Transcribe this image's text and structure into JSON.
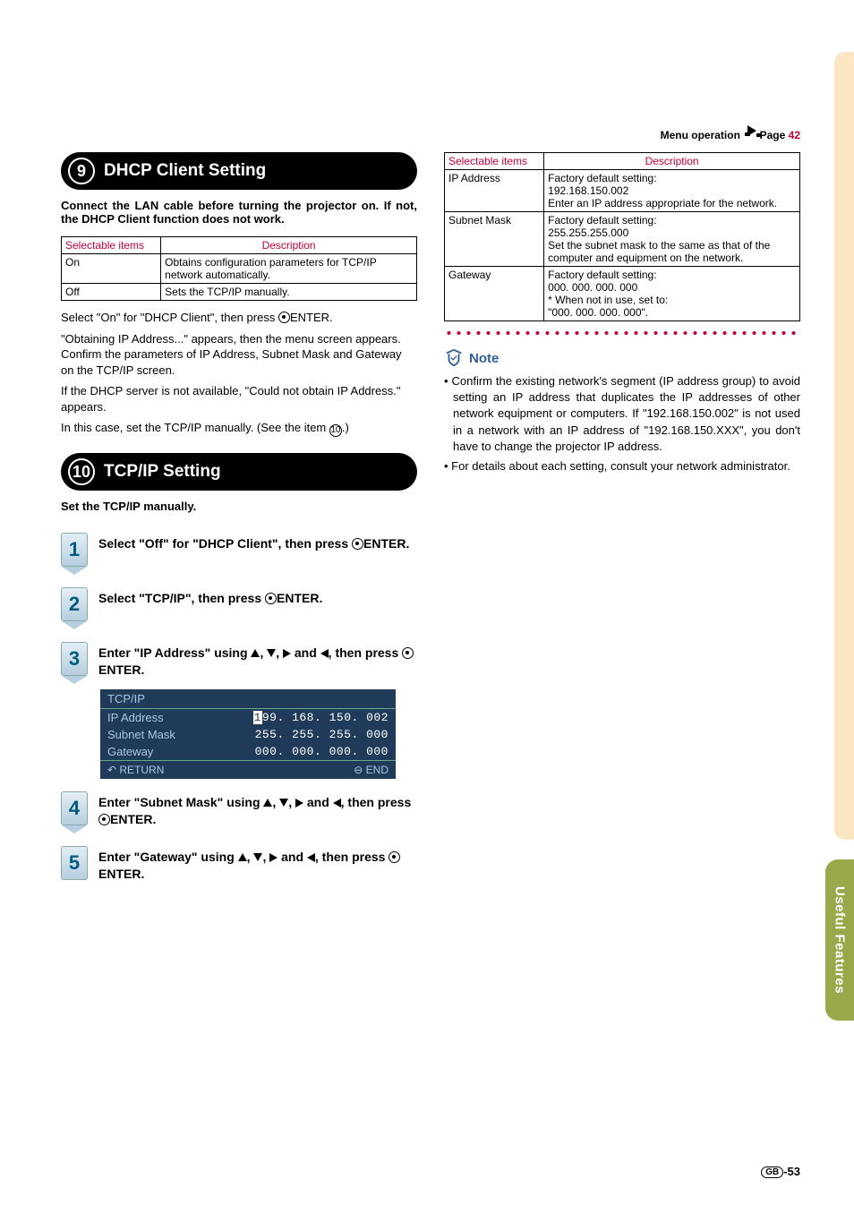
{
  "menu_op": {
    "label": "Menu operation",
    "page_label": "Page",
    "page_num": "42"
  },
  "side_tab": "Useful Features",
  "section9": {
    "num": "9",
    "title": "DHCP Client Setting",
    "intro": "Connect the LAN cable before turning the projector on. If not, the DHCP Client function does not work.",
    "table": {
      "head_sel": "Selectable items",
      "head_desc": "Description",
      "rows": [
        {
          "item": "On",
          "desc": "Obtains configuration parameters for TCP/IP network automatically."
        },
        {
          "item": "Off",
          "desc": "Sets the TCP/IP manually."
        }
      ]
    },
    "para1a": "Select \"On\" for \"DHCP Client\", then press ",
    "para1b": "ENTER.",
    "para2": "\"Obtaining IP Address...\" appears, then the menu screen appears. Confirm the parameters of IP Address, Subnet Mask and Gateway on the TCP/IP screen.",
    "para3": "If the DHCP server is not available, \"Could not obtain IP Address.\" appears.",
    "para4a": "In this case, set the TCP/IP manually. (See the item ",
    "para4_num": "10",
    "para4b": ".)"
  },
  "section10": {
    "num": "10",
    "title": "TCP/IP Setting",
    "intro": "Set the TCP/IP manually.",
    "step1a": "Select \"Off\" for \"DHCP Client\", then press ",
    "step1b": "ENTER.",
    "step2a": "Select \"TCP/IP\", then press ",
    "step2b": "ENTER.",
    "step3a": "Enter \"IP Address\" using ",
    "step3b": " and ",
    "step3c": ", then press ",
    "step3d": "ENTER.",
    "panel": {
      "header": "TCP/IP",
      "rows": [
        {
          "label": "IP Address",
          "value_pre": "1",
          "value_rest": "99. 168. 150. 002"
        },
        {
          "label": "Subnet Mask",
          "value": "255. 255. 255. 000"
        },
        {
          "label": "Gateway",
          "value": "000. 000. 000. 000"
        }
      ],
      "return": "RETURN",
      "end": "END"
    },
    "step4a": "Enter \"Subnet Mask\" using ",
    "step4b": " and ",
    "step4c": ", then press ",
    "step4d": "ENTER.",
    "step5a": "Enter \"Gateway\" using ",
    "step5b": " and ",
    "step5c": ", then press ",
    "step5d": "ENTER."
  },
  "right_table": {
    "head_sel": "Selectable items",
    "head_desc": "Description",
    "rows": [
      {
        "item": "IP Address",
        "desc": "Factory default setting:\n192.168.150.002\nEnter an IP address appropriate for the network."
      },
      {
        "item": "Subnet Mask",
        "desc": "Factory default setting:\n255.255.255.000\nSet the subnet mask to the same as that of the computer and equipment on the network."
      },
      {
        "item": "Gateway",
        "desc": "Factory default setting:\n000. 000. 000. 000\n* When not in use, set to:\n  \"000. 000. 000. 000\"."
      }
    ]
  },
  "note": {
    "label": "Note",
    "items": [
      "Confirm the existing network's segment (IP address group) to avoid setting an IP address that duplicates the IP addresses of other network equipment or computers. If \"192.168.150.002\" is not used in a network with an IP address of \"192.168.150.XXX\", you don't have to change the projector IP address.",
      "For details about each setting, consult your network administrator."
    ]
  },
  "page_num": {
    "region": "GB",
    "num": "-53"
  }
}
